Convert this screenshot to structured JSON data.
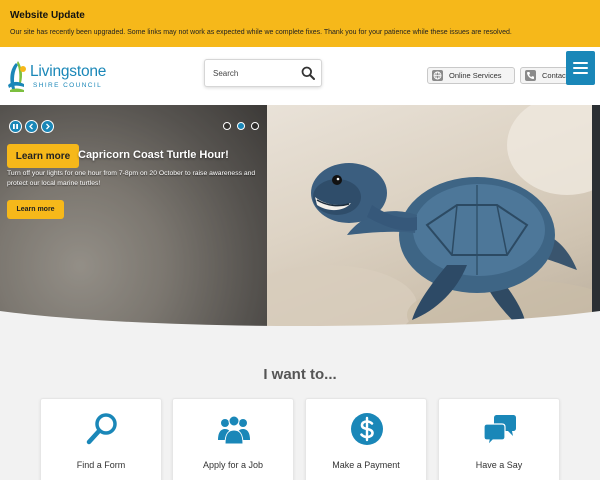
{
  "alert": {
    "title": "Website Update",
    "message": "Our site has recently been upgraded. Some links may not work as expected while we complete fixes. Thank you for your patience while these issues are resolved."
  },
  "header": {
    "logo_name": "Livingstone",
    "logo_sub": "SHIRE COUNCIL",
    "search_placeholder": "Search",
    "online_services_label": "Online Services",
    "contact_label": "Contact Us"
  },
  "hero": {
    "title": "Capricorn Coast Turtle Hour!",
    "text": "Turn off your lights for one hour from 7-8pm on 20 October to raise awareness and protect our local marine turtles!",
    "learn_more_top": "Learn more",
    "learn_more_small": "Learn more",
    "slides": 3,
    "active_slide": 2
  },
  "i_want_to": {
    "title": "I want to...",
    "cards": [
      {
        "label": "Find a Form",
        "icon": "magnifier-icon"
      },
      {
        "label": "Apply for a Job",
        "icon": "people-icon"
      },
      {
        "label": "Make a Payment",
        "icon": "dollar-icon"
      },
      {
        "label": "Have a Say",
        "icon": "speech-bubbles-icon"
      }
    ]
  },
  "colors": {
    "alert_bg": "#f6b81a",
    "brand_blue": "#1a87b8",
    "button_yellow": "#f6b81a"
  }
}
